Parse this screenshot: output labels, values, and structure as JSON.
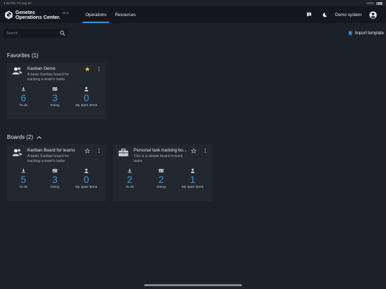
{
  "status_bar": {
    "time": "4:25 PM",
    "date": "Fri Aug 26",
    "battery": "100%"
  },
  "app": {
    "logo_line1": "Genetec",
    "logo_line2": "Operations Center.",
    "beta": "BETA"
  },
  "nav": {
    "items": [
      {
        "label": "Operations",
        "active": true
      },
      {
        "label": "Resources",
        "active": false
      }
    ]
  },
  "header_right": {
    "user_name": "Demo system"
  },
  "toolbar": {
    "search_placeholder": "Search",
    "import_label": "Import template"
  },
  "favorites": {
    "title": "Favorites (1)",
    "cards": [
      {
        "title": "Kanban Demo",
        "description": "A basic Kanban board for tracking a team's tasks",
        "starred": true,
        "icon": "users-icon",
        "stats": [
          {
            "icon": "download-icon",
            "value": "6",
            "label": "To do"
          },
          {
            "icon": "id-card-icon",
            "value": "3",
            "label": "Doing"
          },
          {
            "icon": "person-icon",
            "value": "0",
            "label": "My open items"
          }
        ]
      }
    ]
  },
  "boards": {
    "title": "Boards (2)",
    "cards": [
      {
        "title": "Kanban Board for teams",
        "description": "A basic Kanban board for tracking a team's tasks",
        "starred": false,
        "icon": "users-icon",
        "stats": [
          {
            "icon": "download-icon",
            "value": "5",
            "label": "To do"
          },
          {
            "icon": "id-card-icon",
            "value": "3",
            "label": "Doing"
          },
          {
            "icon": "person-icon",
            "value": "0",
            "label": "My open items"
          }
        ]
      },
      {
        "title": "Personal task tracking bo...",
        "description": "This is a simple board to track tasks",
        "starred": false,
        "icon": "briefcase-icon",
        "stats": [
          {
            "icon": "download-icon",
            "value": "2",
            "label": "To do"
          },
          {
            "icon": "id-card-icon",
            "value": "2",
            "label": "Doing"
          },
          {
            "icon": "person-icon",
            "value": "1",
            "label": "My open items"
          }
        ]
      }
    ]
  },
  "colors": {
    "accent": "#2e9ccf",
    "star_active": "#f2c12e",
    "background": "#1c2028",
    "card": "#23272f",
    "topbar": "#14171d"
  }
}
